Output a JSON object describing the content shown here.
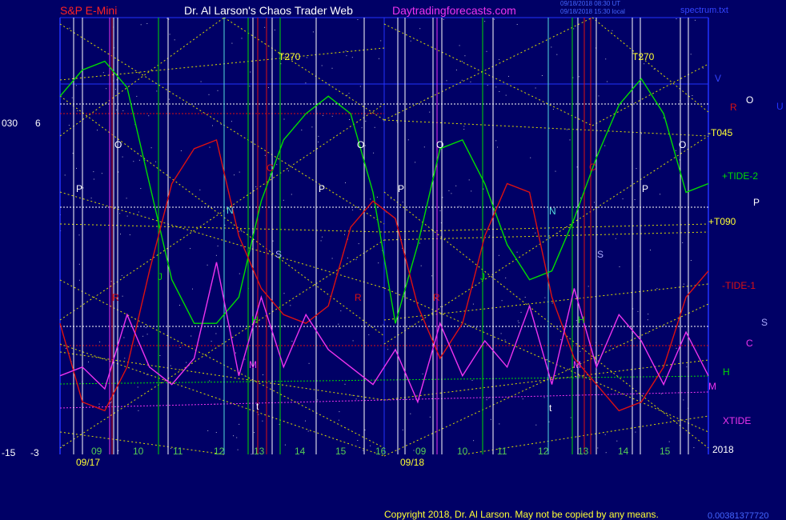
{
  "header": {
    "symbol": "S&P E-Mini",
    "author": "Dr. Al Larson's Chaos Trader Web",
    "site": "Daytradingforecasts.com",
    "stamp1": "09/18/2018 08:30 UT",
    "stamp2": "09/18/2018 15:30 local",
    "file": "spectrum.txt"
  },
  "footer": {
    "copyright": "Copyright 2018, Dr. Al Larson. May not be copied by any means.",
    "code": "0.00381377720"
  },
  "colors": {
    "background": "#000066",
    "green_line": "#00dd00",
    "red_line": "#dd1111",
    "magenta_line": "#ee33ee",
    "yellow_grid": "#dddd00",
    "white_grid": "#ffffff",
    "cyan_line": "#55dddd",
    "blue_axis": "#2233ff"
  },
  "chart_data": {
    "type": "line",
    "title": "S&P E-Mini",
    "left_axis_labels": [
      {
        "text": "030",
        "level": "top"
      },
      {
        "text": "6",
        "level": "top"
      },
      {
        "text": "-15",
        "level": "bottom"
      },
      {
        "text": "-3",
        "level": "bottom"
      }
    ],
    "dates": [
      "09/17",
      "09/18"
    ],
    "year": "2018",
    "hour_ticks": [
      [
        "09",
        "10",
        "11",
        "12",
        "13",
        "14",
        "15",
        "16"
      ],
      [
        "09",
        "10",
        "11",
        "12",
        "13",
        "14",
        "15"
      ]
    ],
    "series": [
      {
        "name": "+TIDE-2",
        "color": "#00dd00",
        "values": [
          0.82,
          0.88,
          0.9,
          0.84,
          0.62,
          0.4,
          0.3,
          0.3,
          0.36,
          0.58,
          0.72,
          0.78,
          0.82,
          0.78,
          0.6,
          0.3,
          0.48,
          0.7,
          0.72,
          0.62,
          0.48,
          0.4,
          0.42,
          0.54,
          0.68,
          0.8,
          0.86,
          0.78,
          0.6,
          0.62
        ]
      },
      {
        "name": "-TIDE-1",
        "color": "#dd1111",
        "values": [
          0.3,
          0.12,
          0.1,
          0.2,
          0.42,
          0.62,
          0.7,
          0.72,
          0.5,
          0.38,
          0.32,
          0.3,
          0.34,
          0.52,
          0.58,
          0.54,
          0.34,
          0.22,
          0.3,
          0.5,
          0.62,
          0.6,
          0.36,
          0.22,
          0.16,
          0.1,
          0.12,
          0.2,
          0.36,
          0.42
        ]
      },
      {
        "name": "XTIDE",
        "color": "#ee33ee",
        "values": [
          0.18,
          0.2,
          0.15,
          0.32,
          0.2,
          0.16,
          0.22,
          0.44,
          0.18,
          0.36,
          0.2,
          0.32,
          0.24,
          0.2,
          0.16,
          0.24,
          0.12,
          0.3,
          0.18,
          0.26,
          0.2,
          0.34,
          0.16,
          0.38,
          0.2,
          0.32,
          0.26,
          0.16,
          0.28,
          0.18
        ]
      }
    ],
    "right_labels": [
      {
        "text": "V",
        "color": "#3344ff"
      },
      {
        "text": "R",
        "color": "#dd1111"
      },
      {
        "text": "O",
        "color": "#ffffff"
      },
      {
        "text": "U",
        "color": "#2233ff"
      },
      {
        "text": "-T045",
        "color": "#ffff33"
      },
      {
        "text": "+TIDE-2",
        "color": "#00dd00"
      },
      {
        "text": "P",
        "color": "#ffffff"
      },
      {
        "text": "+T090",
        "color": "#ffff33"
      },
      {
        "text": "-TIDE-1",
        "color": "#dd1111"
      },
      {
        "text": "S",
        "color": "#aaaaff"
      },
      {
        "text": "C",
        "color": "#ee33ee"
      },
      {
        "text": "H",
        "color": "#00dd00"
      },
      {
        "text": "M",
        "color": "#ee33ee"
      },
      {
        "text": "XTIDE",
        "color": "#ee33ee"
      }
    ],
    "in_chart_letters": [
      {
        "text": "T270",
        "color": "#ffff33"
      },
      {
        "text": "T270",
        "color": "#ffff33"
      },
      {
        "text": "O",
        "color": "#ffffff"
      },
      {
        "text": "O",
        "color": "#ffffff"
      },
      {
        "text": "O",
        "color": "#ffffff"
      },
      {
        "text": "O",
        "color": "#ffffff"
      },
      {
        "text": "P",
        "color": "#ffffff"
      },
      {
        "text": "P",
        "color": "#ffffff"
      },
      {
        "text": "P",
        "color": "#ffffff"
      },
      {
        "text": "P",
        "color": "#ffffff"
      },
      {
        "text": "C",
        "color": "#dd1111"
      },
      {
        "text": "C",
        "color": "#dd1111"
      },
      {
        "text": "N",
        "color": "#55dddd"
      },
      {
        "text": "N",
        "color": "#55dddd"
      },
      {
        "text": "S",
        "color": "#aaaaff"
      },
      {
        "text": "S",
        "color": "#aaaaff"
      },
      {
        "text": "J",
        "color": "#00dd00"
      },
      {
        "text": "J",
        "color": "#00dd00"
      },
      {
        "text": "R",
        "color": "#dd1111"
      },
      {
        "text": "R",
        "color": "#dd1111"
      },
      {
        "text": "R",
        "color": "#dd1111"
      },
      {
        "text": "H",
        "color": "#00dd00"
      },
      {
        "text": "H",
        "color": "#00dd00"
      },
      {
        "text": "M",
        "color": "#ee33ee"
      },
      {
        "text": "M",
        "color": "#ee33ee"
      },
      {
        "text": "t",
        "color": "#ffffff"
      },
      {
        "text": "t",
        "color": "#ffffff"
      }
    ]
  }
}
